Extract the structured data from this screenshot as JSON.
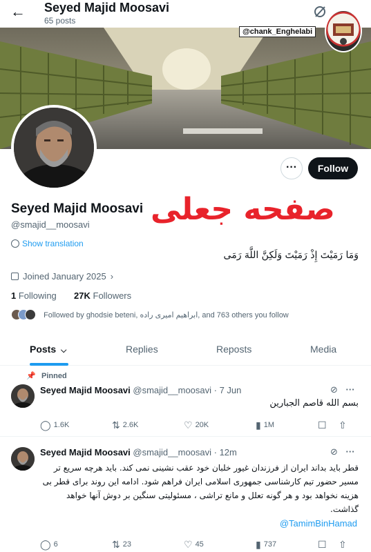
{
  "header": {
    "back_icon": "arrow-left-icon",
    "title": "Seyed Majid Moosavi",
    "post_count": "65 posts",
    "grok_icon": "grok-icon"
  },
  "banner": {
    "watermark": "@chank_Enghelabi",
    "logo_icon": "channel-logo-icon"
  },
  "profile": {
    "display_name": "Seyed Majid Moosavi",
    "handle": "@smajid__moosavi",
    "overlay_text": "صفحه جعلی",
    "show_translation": "Show translation",
    "bio": "وَمَا رَمَيْتَ إِذْ رَمَيْتَ وَلَكِنَّ اللَّهَ رَمَى",
    "joined": "Joined January 2025",
    "following_count": "1",
    "following_label": "Following",
    "followers_count": "27K",
    "followers_label": "Followers",
    "followed_by": "Followed by ghodsie beteni, ابراهیم امیری راده, and 763 others you follow",
    "more_label": "···",
    "follow_label": "Follow"
  },
  "tabs": [
    {
      "label": "Posts",
      "active": true
    },
    {
      "label": "Replies",
      "active": false
    },
    {
      "label": "Reposts",
      "active": false
    },
    {
      "label": "Media",
      "active": false
    }
  ],
  "posts": [
    {
      "pinned_label": "Pinned",
      "name": "Seyed Majid Moosavi",
      "meta": "@smajid__moosavi · 7 Jun",
      "text": "بسم الله قاصم الجبارین",
      "replies": "1.6K",
      "reposts": "2.6K",
      "likes": "20K",
      "views": "1M"
    },
    {
      "name": "Seyed Majid Moosavi",
      "meta": "@smajid__moosavi · 12m",
      "text_lines": [
        "قطر باید بداند ایران از فرزندان غیور خلبان خود عقب نشینی نمی کند. باید هرچه سریع تر",
        "مسیر حضور تیم کارشناسی جمهوری اسلامی ایران فراهم شود. ادامه این روند برای قطر بی",
        "هزینه نخواهد بود و هر گونه تعلل و مانع تراشی ، مسئولیتی سنگین بر دوش آنها خواهد",
        "گذاشت."
      ],
      "mention": "@TamimBinHamad",
      "replies": "6",
      "reposts": "23",
      "likes": "45",
      "views": "737"
    }
  ],
  "colors": {
    "accent": "#1d9bf0",
    "stamp": "#e8232b",
    "text": "#0f1419",
    "muted": "#536471"
  }
}
